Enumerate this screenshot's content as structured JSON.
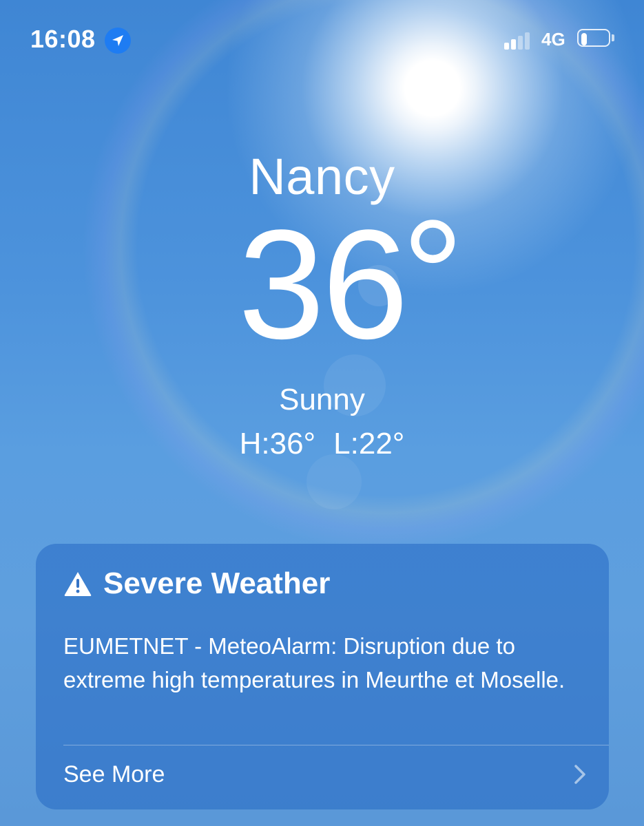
{
  "status_bar": {
    "time": "16:08",
    "location_icon": "location-arrow-icon",
    "signal_bars_active": 2,
    "signal_bars_total": 4,
    "network": "4G",
    "battery_level": 0.2
  },
  "weather": {
    "city": "Nancy",
    "temperature": "36",
    "temperature_unit": "°",
    "condition": "Sunny",
    "high": "H:36°",
    "low": "L:22°"
  },
  "alert": {
    "icon": "warning-triangle-icon",
    "title": "Severe Weather",
    "message": "EUMETNET - MeteoAlarm: Disruption due to extreme high temperatures in Meurthe et Moselle.",
    "see_more_label": "See More",
    "chevron_icon": "chevron-right-icon"
  },
  "colors": {
    "sky_top": "#3f86d4",
    "sky_bottom": "#5a98d8",
    "card_background": "#2468c2",
    "location_badge": "#1e7cf2",
    "text": "#ffffff"
  }
}
